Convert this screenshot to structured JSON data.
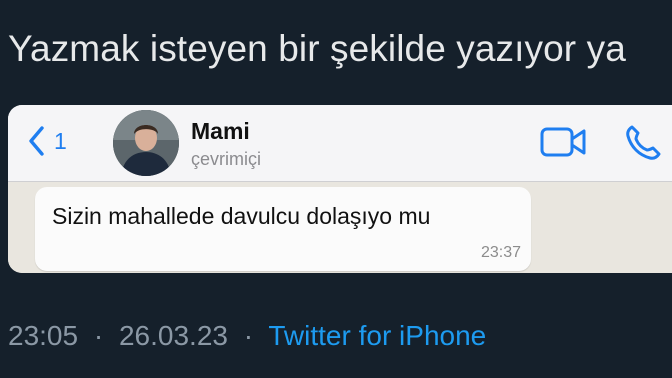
{
  "tweet": {
    "text": "Yazmak isteyen bir şekilde yazıyor ya",
    "time": "23:05",
    "separator": "·",
    "date": "26.03.23",
    "source": "Twitter for iPhone"
  },
  "whatsapp": {
    "back_count": "1",
    "contact_name": "Mami",
    "contact_status": "çevrimiçi",
    "message": {
      "text": "Sizin mahallede davulcu dolaşıyo mu",
      "time": "23:37"
    },
    "accent_color": "#1f7ef0"
  },
  "icons": [
    "chevron-left-icon",
    "video-call-icon",
    "phone-icon"
  ]
}
